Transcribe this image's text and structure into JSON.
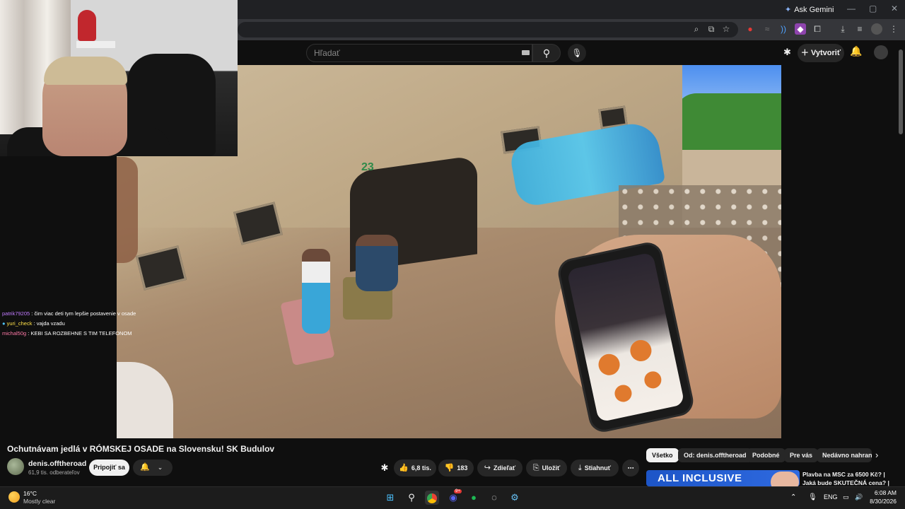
{
  "browser": {
    "gemini_label": "Ask Gemini",
    "window_controls": [
      "—",
      "▢",
      "✕"
    ]
  },
  "youtube_header": {
    "search_placeholder": "Hľadať",
    "create_label": "Vytvoriť"
  },
  "chat": [
    {
      "user": "patrik79205",
      "message": "čim viac deti tym lepšie postavenie v osade"
    },
    {
      "user": "yuri_check",
      "message": "vajda vzadu"
    },
    {
      "user": "michal50g",
      "message": "KEBI SA ROZBEHNE S TIM TELEFONOM"
    }
  ],
  "video": {
    "title": "Ochutnávam jedlá v RÓMSKEJ OSADE na Slovensku! SK Budulov",
    "channel_name": "denis.offtheroad",
    "subscribers": "61,9 tis. odberateľov",
    "join_label": "Pripojiť sa",
    "likes": "6,8 tis.",
    "dislikes": "183",
    "share_label": "Zdieľať",
    "save_label": "Uložiť",
    "download_label": "Stiahnuť",
    "graffiti_number": "23"
  },
  "chips": [
    "Všetko",
    "Od: denis.offtheroad",
    "Podobné",
    "Pre vás",
    "Nedávno nahrané"
  ],
  "recommendation": {
    "thumb_text": "ALL INCLUSIVE",
    "title": "Plavba na MSC za 6500 Kč? | Jaká bude SKUTEČNÁ cena? |"
  },
  "taskbar": {
    "temperature": "16°C",
    "weather": "Mostly clear",
    "language": "ENG",
    "time": "6:08 AM",
    "date": "8/30/2026",
    "discord_badge": "9+"
  },
  "colors": {
    "youtube_bg": "#0f0f0f",
    "pill_bg": "#272727",
    "chrome_bg": "#202124",
    "taskbar_bg": "#1c1c1c"
  }
}
